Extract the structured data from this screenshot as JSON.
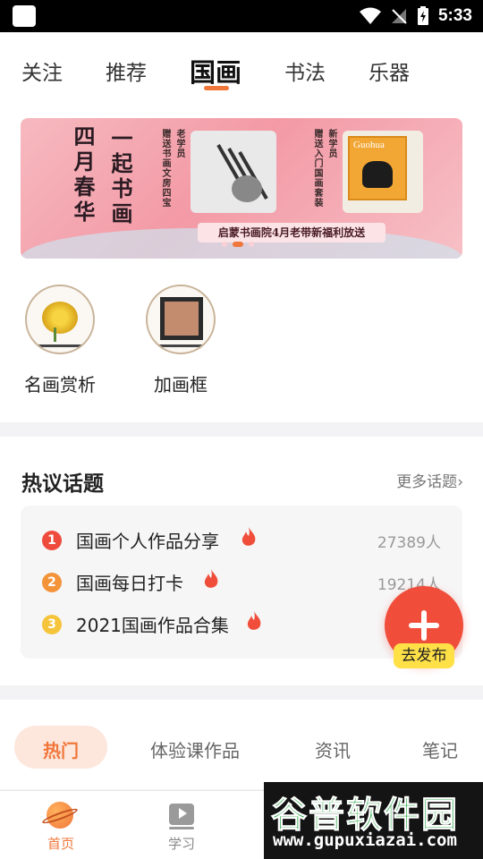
{
  "status_bar": {
    "time": "5:33"
  },
  "top_tabs": [
    {
      "label": "关注",
      "active": false
    },
    {
      "label": "推荐",
      "active": false
    },
    {
      "label": "国画",
      "active": true
    },
    {
      "label": "书法",
      "active": false
    },
    {
      "label": "乐器",
      "active": false
    }
  ],
  "banner": {
    "headline_1": "一起书画",
    "headline_2": "四月春华",
    "gift_1": "赠送书画文房四宝",
    "gift_1_sub": "老学员",
    "gift_2": "赠送入门国画套装",
    "gift_2_sub": "新学员",
    "product_text": "Guohua",
    "caption": "启蒙书画院4月老带新福利放送",
    "dots": 3,
    "active_dot": 1
  },
  "quick_entries": [
    {
      "label": "名画赏析",
      "icon": "chrysanthemum-painting-icon"
    },
    {
      "label": "加画框",
      "icon": "picture-frame-icon"
    }
  ],
  "topics": {
    "title": "热议话题",
    "more": "更多话题",
    "items": [
      {
        "rank": "1",
        "name": "国画个人作品分享",
        "count": "27389人",
        "rank_color": "#ef4b3c"
      },
      {
        "rank": "2",
        "name": "国画每日打卡",
        "count": "19214人",
        "rank_color": "#f3943b"
      },
      {
        "rank": "3",
        "name": "2021国画作品合集",
        "count": "",
        "rank_color": "#f5c43a"
      }
    ]
  },
  "fab": {
    "label": "去发布"
  },
  "category_tabs": [
    {
      "label": "热门",
      "active": true
    },
    {
      "label": "体验课作品",
      "active": false
    },
    {
      "label": "资讯",
      "active": false
    },
    {
      "label": "笔记",
      "active": false
    }
  ],
  "bottom_nav": [
    {
      "label": "首页",
      "active": true,
      "icon": "planet-icon"
    },
    {
      "label": "学习",
      "active": false,
      "icon": "video-play-icon"
    }
  ],
  "watermark": {
    "name": "谷普软件园",
    "url": "www.gupuxiazai.com"
  },
  "colors": {
    "accent": "#f0773b",
    "fab": "#f04e3b",
    "fab_label_bg": "#ffe047"
  }
}
